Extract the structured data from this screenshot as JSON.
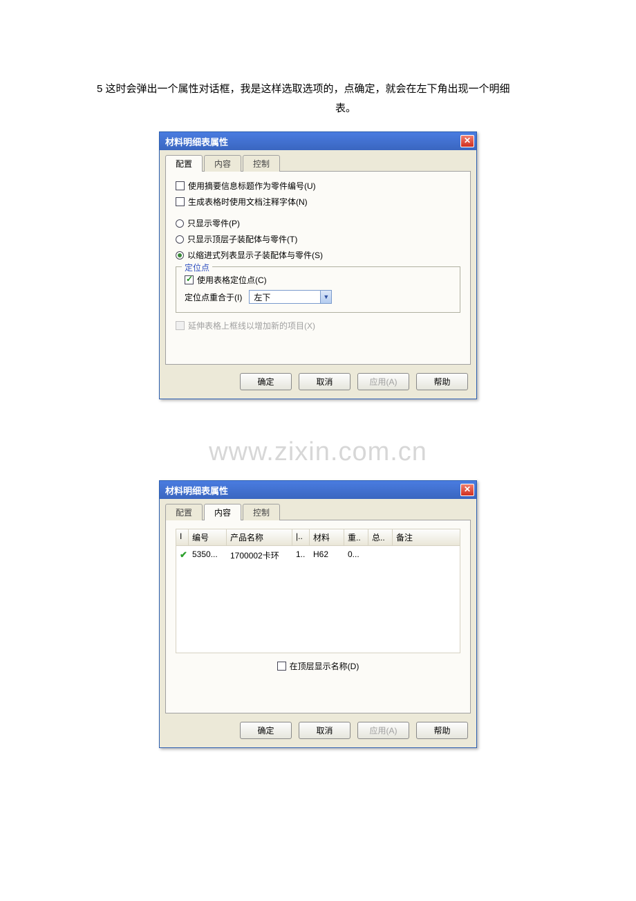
{
  "description": {
    "line1": "5 这时会弹出一个属性对话框，我是这样选取选项的，点确定，就会在左下角出现一个明细",
    "line2": "表。"
  },
  "watermark": "www.zixin.com.cn",
  "dialog1": {
    "title": "材料明细表属性",
    "tabs": {
      "configure": "配置",
      "content": "内容",
      "control": "控制"
    },
    "checkbox_summary": "使用摘要信息标题作为零件编号(U)",
    "checkbox_annotation": "生成表格时使用文档注释字体(N)",
    "radio_parts": "只显示零件(P)",
    "radio_toplevel": "只显示顶层子装配体与零件(T)",
    "radio_indent": "以缩进式列表显示子装配体与零件(S)",
    "anchor_group": "定位点",
    "anchor_check": "使用表格定位点(C)",
    "anchor_coincide": "定位点重合于(I)",
    "anchor_position": "左下",
    "extend_disabled": "延伸表格上框线以增加新的项目(X)",
    "buttons": {
      "ok": "确定",
      "cancel": "取消",
      "apply": "应用(A)",
      "help": "帮助"
    }
  },
  "dialog2": {
    "title": "材料明细表属性",
    "tabs": {
      "configure": "配置",
      "content": "内容",
      "control": "控制"
    },
    "columns": {
      "c0": "I",
      "c1": "编号",
      "c2": "产品名称",
      "c3": "|..",
      "c4": "材料",
      "c5": "重..",
      "c6": "总..",
      "c7": "备注"
    },
    "row": {
      "c1": "5350...",
      "c2": "1700002卡环",
      "c3": "1..",
      "c4": "H62",
      "c5": "0..."
    },
    "show_top": "在顶层显示名称(D)",
    "buttons": {
      "ok": "确定",
      "cancel": "取消",
      "apply": "应用(A)",
      "help": "帮助"
    }
  }
}
